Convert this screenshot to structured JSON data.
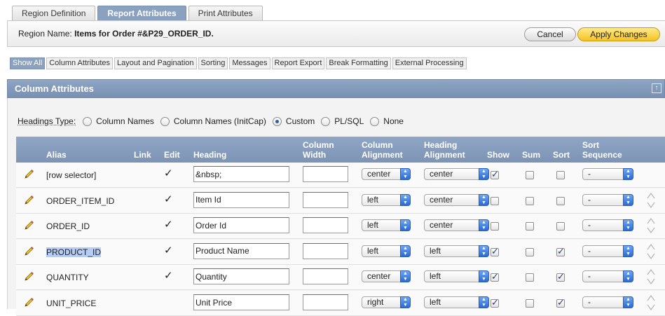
{
  "tabs": [
    {
      "label": "Region Definition",
      "active": false
    },
    {
      "label": "Report Attributes",
      "active": true
    },
    {
      "label": "Print Attributes",
      "active": false
    }
  ],
  "region": {
    "label": "Region Name:",
    "name": "Items for Order #&P29_ORDER_ID.",
    "cancel_label": "Cancel",
    "apply_label": "Apply Changes"
  },
  "subnav": [
    {
      "label": "Show All",
      "active": true
    },
    {
      "label": "Column Attributes",
      "active": false
    },
    {
      "label": "Layout and Pagination",
      "active": false
    },
    {
      "label": "Sorting",
      "active": false
    },
    {
      "label": "Messages",
      "active": false
    },
    {
      "label": "Report Export",
      "active": false
    },
    {
      "label": "Break Formatting",
      "active": false
    },
    {
      "label": "External Processing",
      "active": false
    }
  ],
  "panel": {
    "title": "Column Attributes",
    "collapse_icon": "↑"
  },
  "headings_type": {
    "label": "Headings Type:",
    "options": [
      {
        "label": "Column Names",
        "checked": false
      },
      {
        "label": "Column Names (InitCap)",
        "checked": false
      },
      {
        "label": "Custom",
        "checked": true
      },
      {
        "label": "PL/SQL",
        "checked": false
      },
      {
        "label": "None",
        "checked": false
      }
    ]
  },
  "columns": {
    "alias": "Alias",
    "link": "Link",
    "edit": "Edit",
    "heading": "Heading",
    "column_width_1": "Column",
    "column_width_2": "Width",
    "column_alignment_1": "Column",
    "column_alignment_2": "Alignment",
    "heading_alignment_1": "Heading",
    "heading_alignment_2": "Alignment",
    "show": "Show",
    "sum": "Sum",
    "sort": "Sort",
    "sort_sequence_1": "Sort",
    "sort_sequence_2": "Sequence"
  },
  "rows": [
    {
      "alias": "[row selector]",
      "edit_mark": "✓",
      "heading": "&nbsp;",
      "width": "",
      "col_align": "center",
      "head_align": "center",
      "show": true,
      "sum": false,
      "sort": false,
      "seq": "-",
      "highlight": false,
      "mover": false
    },
    {
      "alias": "ORDER_ITEM_ID",
      "edit_mark": "✓",
      "heading": "Item Id",
      "width": "",
      "col_align": "left",
      "head_align": "center",
      "show": false,
      "sum": false,
      "sort": false,
      "seq": "-",
      "highlight": false,
      "mover": true
    },
    {
      "alias": "ORDER_ID",
      "edit_mark": "✓",
      "heading": "Order Id",
      "width": "",
      "col_align": "left",
      "head_align": "center",
      "show": false,
      "sum": false,
      "sort": false,
      "seq": "-",
      "highlight": false,
      "mover": true
    },
    {
      "alias": "PRODUCT_ID",
      "edit_mark": "✓",
      "heading": "Product Name",
      "width": "",
      "col_align": "left",
      "head_align": "left",
      "show": true,
      "sum": false,
      "sort": true,
      "seq": "-",
      "highlight": true,
      "mover": true
    },
    {
      "alias": "QUANTITY",
      "edit_mark": "✓",
      "heading": "Quantity",
      "width": "",
      "col_align": "center",
      "head_align": "left",
      "show": true,
      "sum": false,
      "sort": true,
      "seq": "-",
      "highlight": false,
      "mover": true
    },
    {
      "alias": "UNIT_PRICE",
      "edit_mark": "",
      "heading": "Unit Price",
      "width": "",
      "col_align": "right",
      "head_align": "left",
      "show": true,
      "sum": false,
      "sort": true,
      "seq": "-",
      "highlight": false,
      "mover": true
    }
  ],
  "icons": {
    "edit": "pencil-icon",
    "mover": "up-down-arrows-icon",
    "select_arrow": "select-arrow-icon"
  },
  "colors": {
    "accent": "#8aa1c0",
    "apply_button": "#f6c422",
    "selection_highlight": "#b5cdf3",
    "select_arrow": "#2a6bd6"
  }
}
